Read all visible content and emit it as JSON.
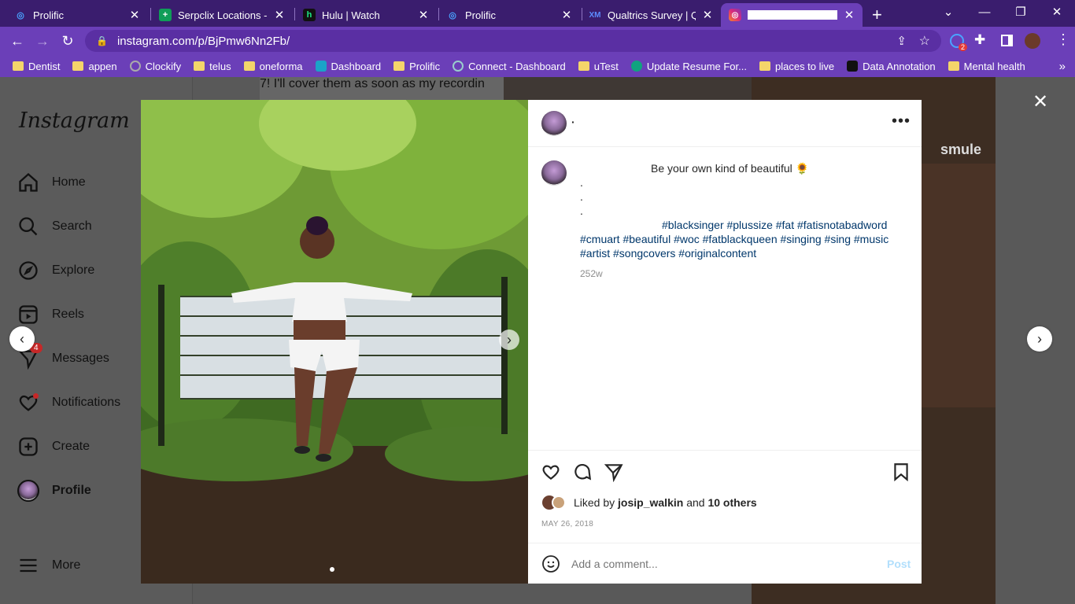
{
  "browser": {
    "tabs": [
      {
        "title": "Prolific",
        "favicon": "prolific-icon",
        "color": "#1e90ff"
      },
      {
        "title": "Serpclix Locations - Go",
        "favicon": "sheets-icon",
        "color": "#0f9d58"
      },
      {
        "title": "Hulu | Watch",
        "favicon": "hulu-icon",
        "color": "#1ce783"
      },
      {
        "title": "Prolific",
        "favicon": "prolific-icon",
        "color": "#1e90ff"
      },
      {
        "title": "Qualtrics Survey | Qua",
        "favicon": "qualtrics-icon",
        "color": "#3b5fff"
      },
      {
        "title": "",
        "favicon": "instagram-icon",
        "color": "#e1306c"
      }
    ],
    "url": "instagram.com/p/BjPmw6Nn2Fb/",
    "bookmarks": [
      {
        "label": "Dentist",
        "type": "folder"
      },
      {
        "label": "appen",
        "type": "folder"
      },
      {
        "label": "Clockify",
        "type": "site"
      },
      {
        "label": "telus",
        "type": "folder"
      },
      {
        "label": "oneforma",
        "type": "folder"
      },
      {
        "label": "Dashboard",
        "type": "site"
      },
      {
        "label": "Prolific",
        "type": "folder"
      },
      {
        "label": "Connect - Dashboard",
        "type": "site"
      },
      {
        "label": "uTest",
        "type": "folder"
      },
      {
        "label": "Update Resume For...",
        "type": "site"
      },
      {
        "label": "places to live",
        "type": "folder"
      },
      {
        "label": "Data Annotation",
        "type": "site"
      },
      {
        "label": "Mental health",
        "type": "folder"
      }
    ],
    "extension_badge": "2"
  },
  "sidebar": {
    "logo": "Instagram",
    "items": [
      {
        "label": "Home",
        "icon": "home-icon"
      },
      {
        "label": "Search",
        "icon": "search-icon"
      },
      {
        "label": "Explore",
        "icon": "compass-icon"
      },
      {
        "label": "Reels",
        "icon": "reels-icon"
      },
      {
        "label": "Messages",
        "icon": "messenger-icon",
        "badge": "4"
      },
      {
        "label": "Notifications",
        "icon": "heart-icon"
      },
      {
        "label": "Create",
        "icon": "plus-square-icon"
      },
      {
        "label": "Profile",
        "icon": "avatar"
      },
      {
        "label": "More",
        "icon": "menu-icon"
      }
    ]
  },
  "background": {
    "partial_text": "7! I'll cover them as soon as my recordin",
    "watermark": "smule"
  },
  "post": {
    "username": "·",
    "caption_line": "Be your own kind of beautiful 🌻",
    "dots": [
      ".",
      ".",
      "."
    ],
    "hashtags": "#blacksinger #plussize #fat #fatisnotabadword #cmuart #beautiful #woc #fatblackqueen #singing #sing #music #artist #songcovers #originalcontent",
    "age": "252w",
    "liked_by_prefix": "Liked by",
    "liked_by_user": "josip_walkin",
    "liked_by_and": "and",
    "liked_by_others": "10 others",
    "date": "MAY 26, 2018",
    "comment_placeholder": "Add a comment...",
    "post_button": "Post"
  }
}
